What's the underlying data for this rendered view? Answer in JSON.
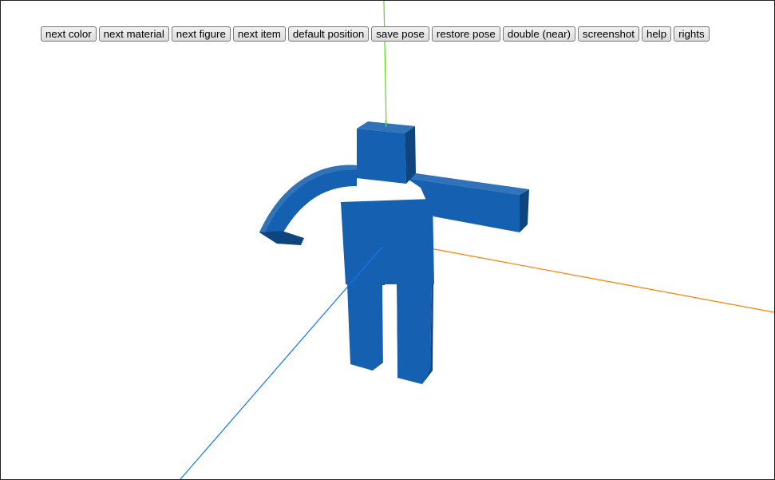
{
  "toolbar": {
    "buttons": [
      {
        "id": "next-color",
        "label": "next color"
      },
      {
        "id": "next-material",
        "label": "next material"
      },
      {
        "id": "next-figure",
        "label": "next figure"
      },
      {
        "id": "next-item",
        "label": "next item"
      },
      {
        "id": "default-position",
        "label": "default position"
      },
      {
        "id": "save-pose",
        "label": "save pose"
      },
      {
        "id": "restore-pose",
        "label": "restore pose"
      },
      {
        "id": "double-near",
        "label": "double (near)"
      },
      {
        "id": "screenshot",
        "label": "screenshot"
      },
      {
        "id": "help",
        "label": "help"
      },
      {
        "id": "rights",
        "label": "rights"
      }
    ]
  },
  "scene": {
    "figure_color": "#1560b0",
    "axis_colors": {
      "x": "#ff7f00",
      "y": "#55dd11",
      "z": "#1177ee"
    }
  }
}
